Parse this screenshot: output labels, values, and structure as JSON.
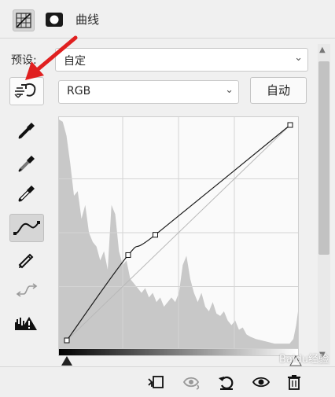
{
  "panel": {
    "title": "曲线",
    "preset_label": "预设:",
    "preset_value": "自定",
    "channel_value": "RGB",
    "auto_label": "自动"
  },
  "icons": {
    "header": [
      "curves-adjustment-icon",
      "layer-mask-icon"
    ],
    "tools": [
      "targeted-adjustment-icon",
      "black-point-eyedropper-icon",
      "gray-point-eyedropper-icon",
      "white-point-eyedropper-icon",
      "curve-points-icon",
      "pencil-draw-icon",
      "smooth-curve-icon",
      "clipping-warning-icon"
    ],
    "footer": [
      "clip-to-layer-icon",
      "view-previous-state-icon",
      "reset-icon",
      "toggle-visibility-icon",
      "delete-icon"
    ]
  },
  "curve": {
    "input_range": [
      0,
      255
    ],
    "output_range": [
      0,
      255
    ],
    "points": [
      [
        0,
        0
      ],
      [
        70,
        101
      ],
      [
        101,
        125
      ],
      [
        255,
        255
      ]
    ]
  },
  "colors": {
    "annotation_arrow": "#e02020",
    "histogram": "#c8c8c8",
    "active_tool_bg": "#d6d6d6"
  },
  "watermark": "Baidu经验"
}
